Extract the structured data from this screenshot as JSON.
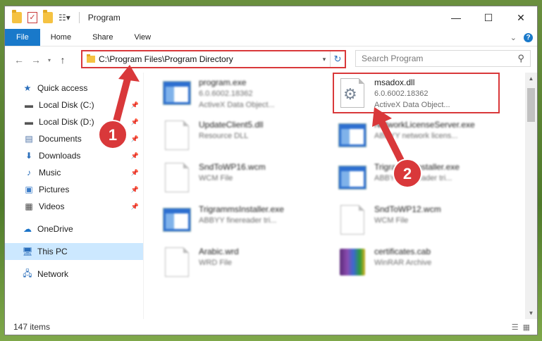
{
  "window": {
    "title": "Program"
  },
  "ribbon": {
    "tabs": [
      "File",
      "Home",
      "Share",
      "View"
    ],
    "help_glyph": "?"
  },
  "address": {
    "path": "C:\\Program Files\\Program Directory"
  },
  "search": {
    "placeholder": "Search Program"
  },
  "sidebar": {
    "items": [
      {
        "label": "Quick access",
        "icon": "star-icon"
      },
      {
        "label": "Local Disk (C:)",
        "icon": "drive-icon",
        "pinned": true
      },
      {
        "label": "Local Disk (D:)",
        "icon": "drive-icon",
        "pinned": true
      },
      {
        "label": "Documents",
        "icon": "documents-icon",
        "pinned": true
      },
      {
        "label": "Downloads",
        "icon": "download-icon",
        "pinned": true
      },
      {
        "label": "Music",
        "icon": "music-icon",
        "pinned": true
      },
      {
        "label": "Pictures",
        "icon": "pictures-icon",
        "pinned": true
      },
      {
        "label": "Videos",
        "icon": "videos-icon",
        "pinned": true
      },
      {
        "label": "OneDrive",
        "icon": "cloud-icon"
      },
      {
        "label": "This PC",
        "icon": "computer-icon",
        "selected": true
      },
      {
        "label": "Network",
        "icon": "network-icon"
      }
    ]
  },
  "files": [
    {
      "name": "program.exe",
      "line2": "6.0.6002.18362",
      "line3": "ActiveX Data Object...",
      "icon": "exe-icon"
    },
    {
      "name": "msadox.dll",
      "line2": "6.0.6002.18362",
      "line3": "ActiveX Data Object...",
      "icon": "gear-dll-icon"
    },
    {
      "name": "UpdateClient5.dll",
      "line2": "Resource DLL",
      "icon": "dll-icon"
    },
    {
      "name": "NetworkLicenseServer.exe",
      "line2": "ABBYY network licens...",
      "icon": "exe-icon"
    },
    {
      "name": "SndToWP16.wcm",
      "line2": "WCM File",
      "icon": "file-icon"
    },
    {
      "name": "TrigrammsInstaller.exe",
      "line2": "ABBYY finereader tri...",
      "icon": "exe-icon"
    },
    {
      "name": "TrigrammsInstaller.exe",
      "line2": "ABBYY finereader tri...",
      "icon": "exe-icon"
    },
    {
      "name": "SndToWP12.wcm",
      "line2": "WCM File",
      "icon": "file-icon"
    },
    {
      "name": "Arabic.wrd",
      "line2": "WRD File",
      "icon": "file-icon"
    },
    {
      "name": "certificates.cab",
      "line2": "WinRAR Archive",
      "icon": "winrar-icon"
    }
  ],
  "status": {
    "count": "147 items"
  },
  "callouts": {
    "one": "1",
    "two": "2"
  },
  "colors": {
    "accent": "#1979ca",
    "highlight": "#d9383a"
  }
}
